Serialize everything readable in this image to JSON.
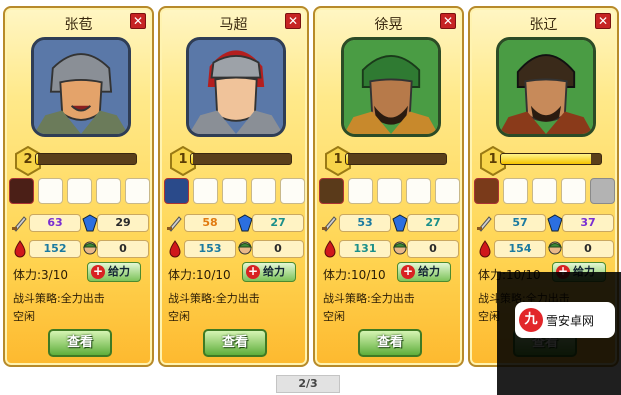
{
  "pagination": {
    "label": "2/3"
  },
  "watermark": {
    "text": "雪安卓网"
  },
  "generals": [
    {
      "name": "张苞",
      "level": "2",
      "xp_fraction": 0.02,
      "equipment": [
        "item",
        "empty",
        "empty",
        "empty",
        "empty"
      ],
      "attack": "63",
      "intelligence": "29",
      "defense": "152",
      "soldiers": "0",
      "stamina_label": "体力:",
      "stamina": "3/10",
      "heal_label": "给力",
      "strategy": "战斗策略:全力出击",
      "status": "空闲",
      "view_label": "查看",
      "portrait_bg": "blue"
    },
    {
      "name": "马超",
      "level": "1",
      "xp_fraction": 0.02,
      "equipment": [
        "item",
        "empty",
        "empty",
        "empty",
        "empty"
      ],
      "attack": "58",
      "intelligence": "27",
      "defense": "153",
      "soldiers": "0",
      "stamina_label": "体力:",
      "stamina": "10/10",
      "heal_label": "给力",
      "strategy": "战斗策略:全力出击",
      "status": "空闲",
      "view_label": "查看",
      "portrait_bg": "blue"
    },
    {
      "name": "徐晃",
      "level": "1",
      "xp_fraction": 0.02,
      "equipment": [
        "item",
        "empty",
        "empty",
        "empty",
        "empty"
      ],
      "attack": "53",
      "intelligence": "27",
      "defense": "131",
      "soldiers": "0",
      "stamina_label": "体力:",
      "stamina": "10/10",
      "heal_label": "给力",
      "strategy": "战斗策略:全力出击",
      "status": "空闲",
      "view_label": "查看",
      "portrait_bg": "green"
    },
    {
      "name": "张辽",
      "level": "1",
      "xp_fraction": 0.9,
      "equipment": [
        "item",
        "empty",
        "empty",
        "empty",
        "locked"
      ],
      "attack": "57",
      "intelligence": "37",
      "defense": "154",
      "soldiers": "0",
      "stamina_label": "体力:",
      "stamina": "10/10",
      "heal_label": "给力",
      "strategy": "战斗策略:全力出击",
      "status": "空闲",
      "view_label": "查看",
      "portrait_bg": "green"
    }
  ]
}
